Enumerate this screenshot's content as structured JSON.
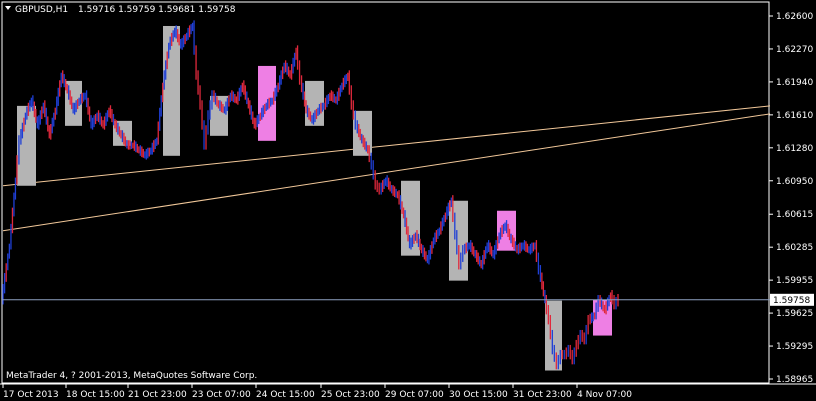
{
  "header": {
    "symbol_timeframe": "GBPUSD,H1",
    "ohlc": "1.59716 1.59759 1.59681 1.59758"
  },
  "copyright": "MetaTrader 4, ? 2001-2013, MetaQuotes Software Corp.",
  "price_tag": "1.59758",
  "colors": {
    "background": "#000000",
    "axis": "#ffffff",
    "bull_candle": "#1f3fd6",
    "bear_candle": "#e0283c",
    "box_gray": "#b4b4b4",
    "box_pink": "#ee7fe4",
    "trendline": "#f2c89a",
    "bid_line": "#8ea0c0"
  },
  "chart_data": {
    "type": "line",
    "series_note": "hourly close path, approximate",
    "y_ticks": [
      "1.62600",
      "1.62270",
      "1.61940",
      "1.61610",
      "1.61280",
      "1.60950",
      "1.60615",
      "1.60285",
      "1.59955",
      "1.59625",
      "1.59295",
      "1.58965"
    ],
    "x_ticks": [
      "17 Oct 2013",
      "18 Oct 15:00",
      "21 Oct 23:00",
      "23 Oct 07:00",
      "24 Oct 15:00",
      "25 Oct 23:00",
      "29 Oct 07:00",
      "30 Oct 15:00",
      "31 Oct 23:00",
      "4 Nov 07:00"
    ],
    "ylim": [
      1.58965,
      1.626
    ],
    "x_count": 620,
    "path": [
      [
        0,
        1.5975
      ],
      [
        8,
        1.603
      ],
      [
        14,
        1.6095
      ],
      [
        18,
        1.6135
      ],
      [
        24,
        1.616
      ],
      [
        30,
        1.6175
      ],
      [
        36,
        1.615
      ],
      [
        42,
        1.617
      ],
      [
        48,
        1.614
      ],
      [
        54,
        1.6165
      ],
      [
        60,
        1.62
      ],
      [
        66,
        1.6185
      ],
      [
        72,
        1.6165
      ],
      [
        78,
        1.6175
      ],
      [
        84,
        1.618
      ],
      [
        90,
        1.615
      ],
      [
        96,
        1.616
      ],
      [
        102,
        1.615
      ],
      [
        108,
        1.6165
      ],
      [
        114,
        1.615
      ],
      [
        120,
        1.614
      ],
      [
        126,
        1.613
      ],
      [
        132,
        1.613
      ],
      [
        138,
        1.6125
      ],
      [
        144,
        1.612
      ],
      [
        150,
        1.6125
      ],
      [
        156,
        1.6135
      ],
      [
        162,
        1.619
      ],
      [
        168,
        1.623
      ],
      [
        174,
        1.6245
      ],
      [
        180,
        1.623
      ],
      [
        186,
        1.624
      ],
      [
        192,
        1.625
      ],
      [
        196,
        1.62
      ],
      [
        200,
        1.617
      ],
      [
        204,
        1.613
      ],
      [
        208,
        1.616
      ],
      [
        212,
        1.618
      ],
      [
        218,
        1.617
      ],
      [
        224,
        1.6165
      ],
      [
        230,
        1.618
      ],
      [
        236,
        1.6175
      ],
      [
        242,
        1.619
      ],
      [
        248,
        1.617
      ],
      [
        254,
        1.615
      ],
      [
        260,
        1.616
      ],
      [
        266,
        1.617
      ],
      [
        272,
        1.6175
      ],
      [
        278,
        1.619
      ],
      [
        284,
        1.621
      ],
      [
        290,
        1.62
      ],
      [
        296,
        1.6225
      ],
      [
        300,
        1.6195
      ],
      [
        306,
        1.6165
      ],
      [
        312,
        1.6155
      ],
      [
        318,
        1.6165
      ],
      [
        324,
        1.617
      ],
      [
        330,
        1.618
      ],
      [
        336,
        1.6175
      ],
      [
        342,
        1.619
      ],
      [
        348,
        1.62
      ],
      [
        352,
        1.617
      ],
      [
        356,
        1.615
      ],
      [
        362,
        1.6135
      ],
      [
        368,
        1.6125
      ],
      [
        372,
        1.611
      ],
      [
        376,
        1.609
      ],
      [
        380,
        1.6085
      ],
      [
        386,
        1.6095
      ],
      [
        392,
        1.6085
      ],
      [
        398,
        1.608
      ],
      [
        404,
        1.606
      ],
      [
        410,
        1.603
      ],
      [
        416,
        1.604
      ],
      [
        422,
        1.6025
      ],
      [
        428,
        1.6015
      ],
      [
        434,
        1.6035
      ],
      [
        440,
        1.6045
      ],
      [
        446,
        1.606
      ],
      [
        452,
        1.6075
      ],
      [
        456,
        1.604
      ],
      [
        460,
        1.601
      ],
      [
        464,
        1.6025
      ],
      [
        470,
        1.603
      ],
      [
        476,
        1.602
      ],
      [
        482,
        1.601
      ],
      [
        488,
        1.603
      ],
      [
        494,
        1.602
      ],
      [
        500,
        1.604
      ],
      [
        506,
        1.605
      ],
      [
        512,
        1.6035
      ],
      [
        518,
        1.6025
      ],
      [
        524,
        1.603
      ],
      [
        530,
        1.6025
      ],
      [
        536,
        1.603
      ],
      [
        540,
        1.6005
      ],
      [
        546,
        1.5975
      ],
      [
        550,
        1.5955
      ],
      [
        554,
        1.5925
      ],
      [
        558,
        1.591
      ],
      [
        562,
        1.592
      ],
      [
        566,
        1.592
      ],
      [
        570,
        1.5925
      ],
      [
        574,
        1.5915
      ],
      [
        578,
        1.593
      ],
      [
        582,
        1.594
      ],
      [
        586,
        1.5935
      ],
      [
        590,
        1.5955
      ],
      [
        596,
        1.596
      ],
      [
        600,
        1.5975
      ],
      [
        606,
        1.5965
      ],
      [
        612,
        1.598
      ],
      [
        616,
        1.597
      ],
      [
        620,
        1.5976
      ]
    ],
    "boxes": [
      {
        "x0": 17,
        "x1": 36,
        "y0": 1.617,
        "y1": 1.609,
        "color": "gray"
      },
      {
        "x0": 65,
        "x1": 82,
        "y0": 1.6195,
        "y1": 1.615,
        "color": "gray"
      },
      {
        "x0": 113,
        "x1": 132,
        "y0": 1.6155,
        "y1": 1.613,
        "color": "gray"
      },
      {
        "x0": 163,
        "x1": 180,
        "y0": 1.625,
        "y1": 1.612,
        "color": "gray"
      },
      {
        "x0": 210,
        "x1": 228,
        "y0": 1.618,
        "y1": 1.614,
        "color": "gray"
      },
      {
        "x0": 258,
        "x1": 276,
        "y0": 1.621,
        "y1": 1.6135,
        "color": "pink"
      },
      {
        "x0": 305,
        "x1": 324,
        "y0": 1.6195,
        "y1": 1.615,
        "color": "gray"
      },
      {
        "x0": 353,
        "x1": 372,
        "y0": 1.6165,
        "y1": 1.612,
        "color": "gray"
      },
      {
        "x0": 401,
        "x1": 420,
        "y0": 1.6095,
        "y1": 1.602,
        "color": "gray"
      },
      {
        "x0": 449,
        "x1": 468,
        "y0": 1.6075,
        "y1": 1.5995,
        "color": "gray"
      },
      {
        "x0": 497,
        "x1": 516,
        "y0": 1.6065,
        "y1": 1.6025,
        "color": "pink"
      },
      {
        "x0": 545,
        "x1": 562,
        "y0": 1.5975,
        "y1": 1.5905,
        "color": "gray"
      },
      {
        "x0": 593,
        "x1": 612,
        "y0": 1.5976,
        "y1": 1.594,
        "color": "pink"
      }
    ],
    "trendlines": [
      {
        "x0": 0,
        "y0": 1.609,
        "x1": 770,
        "y1": 1.617
      },
      {
        "x0": 0,
        "y0": 1.6045,
        "x1": 770,
        "y1": 1.6162
      }
    ],
    "bid_level": 1.59758
  }
}
